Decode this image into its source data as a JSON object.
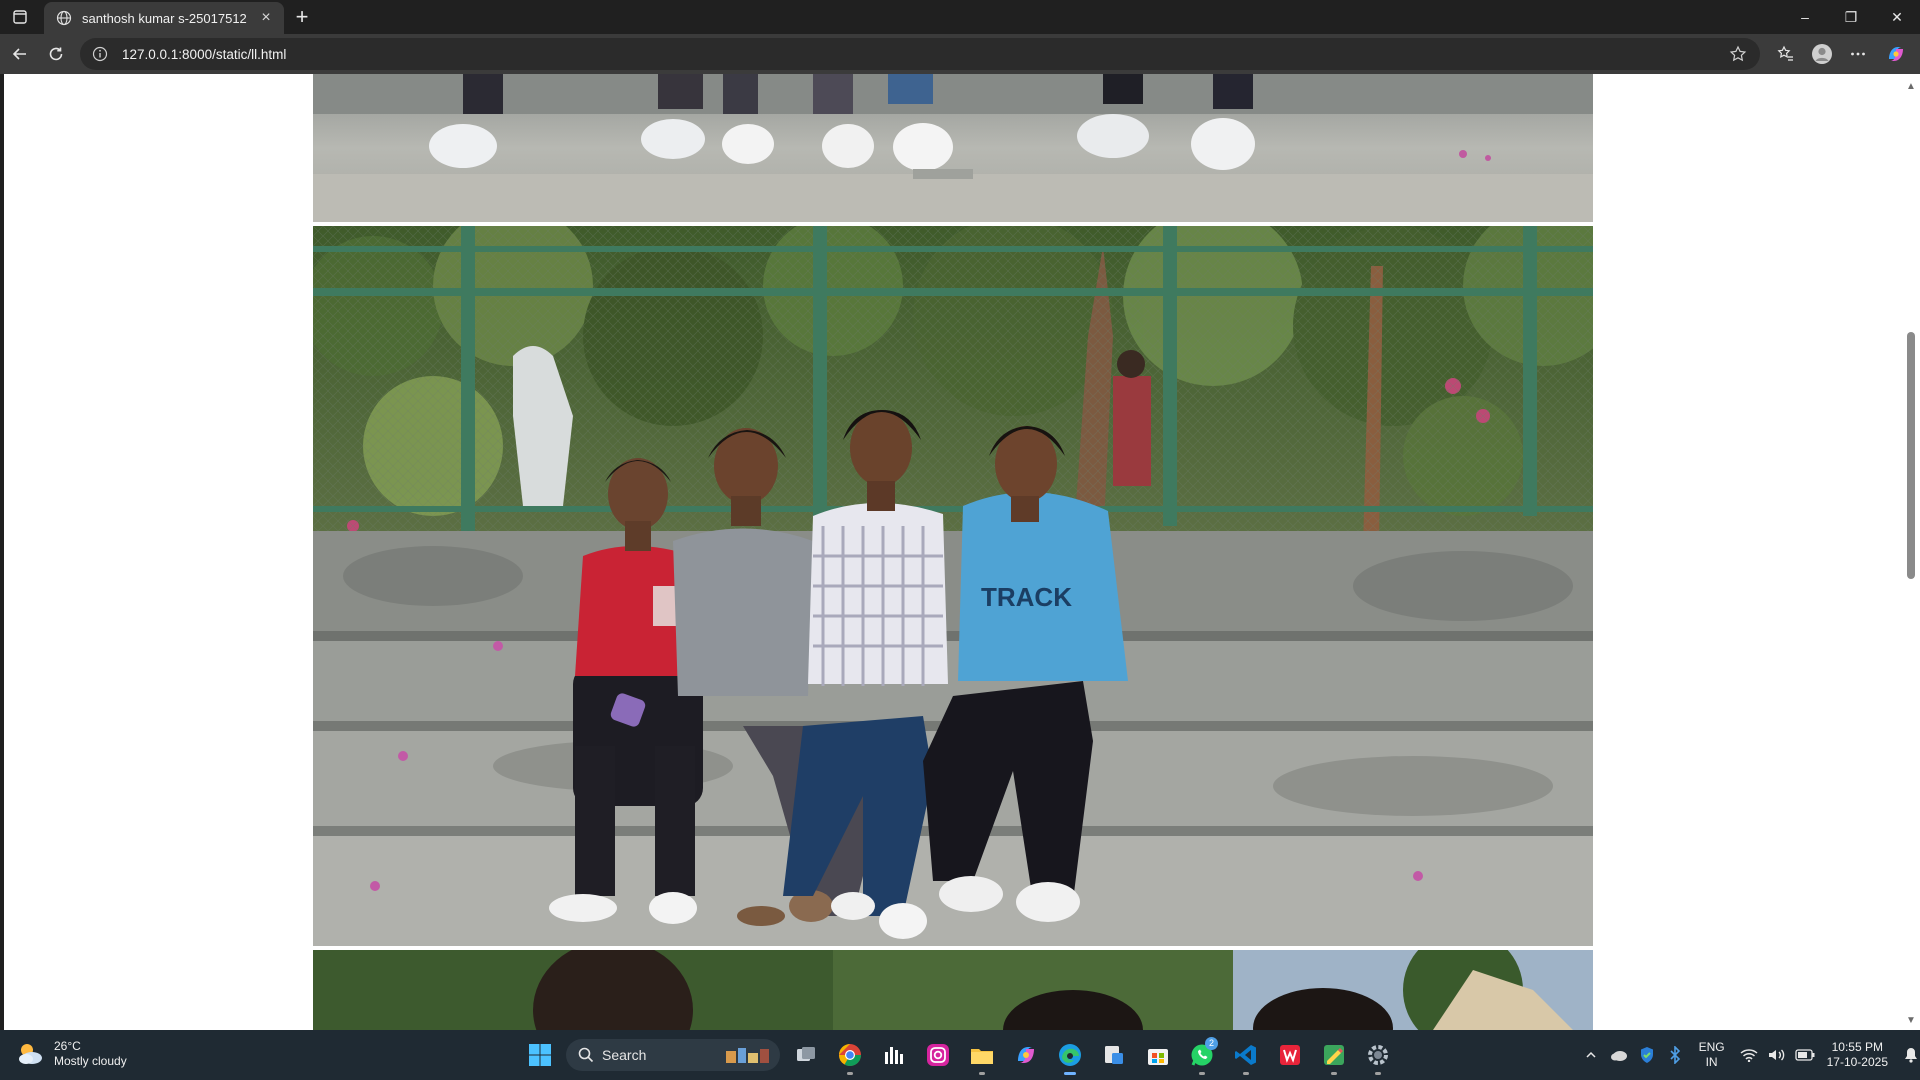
{
  "browser": {
    "tab": {
      "title": "santhosh kumar s-25017512",
      "close_glyph": "×"
    },
    "new_tab_glyph": "+",
    "address": {
      "url": "127.0.0.1:8000/static/ll.html"
    },
    "window_controls": {
      "minimize": "–",
      "restore": "❐",
      "close": "✕"
    }
  },
  "page": {
    "photos": [
      {
        "name": "photo-feet-strip",
        "icon": "photo-image"
      },
      {
        "name": "photo-four-friends-sitting-on-steps",
        "icon": "photo-image"
      },
      {
        "name": "photo-partial-next",
        "icon": "photo-image"
      }
    ],
    "scrollbar": {
      "position_fraction": 0.26,
      "visible_fraction": 0.27
    }
  },
  "taskbar": {
    "weather": {
      "temp": "26°C",
      "condition": "Mostly cloudy",
      "icon": "cloud-sun-icon"
    },
    "search_label": "Search",
    "apps": [
      "windows-start-icon",
      "task-view-icon",
      "chrome-icon",
      "audio-app-icon",
      "instagram-icon",
      "file-explorer-icon",
      "copilot-icon",
      "edge-icon",
      "snip-tool-icon",
      "store-icon",
      "whatsapp-icon",
      "vscode-icon",
      "office-icon",
      "paint-icon",
      "settings-icon"
    ],
    "whatsapp_badge": "2",
    "language": {
      "line1": "ENG",
      "line2": "IN"
    },
    "clock": {
      "time": "10:55 PM",
      "date": "17-10-2025"
    },
    "colors": {
      "accent": "#6fb3ff",
      "taskbar_bg": "#1f2a33"
    }
  }
}
